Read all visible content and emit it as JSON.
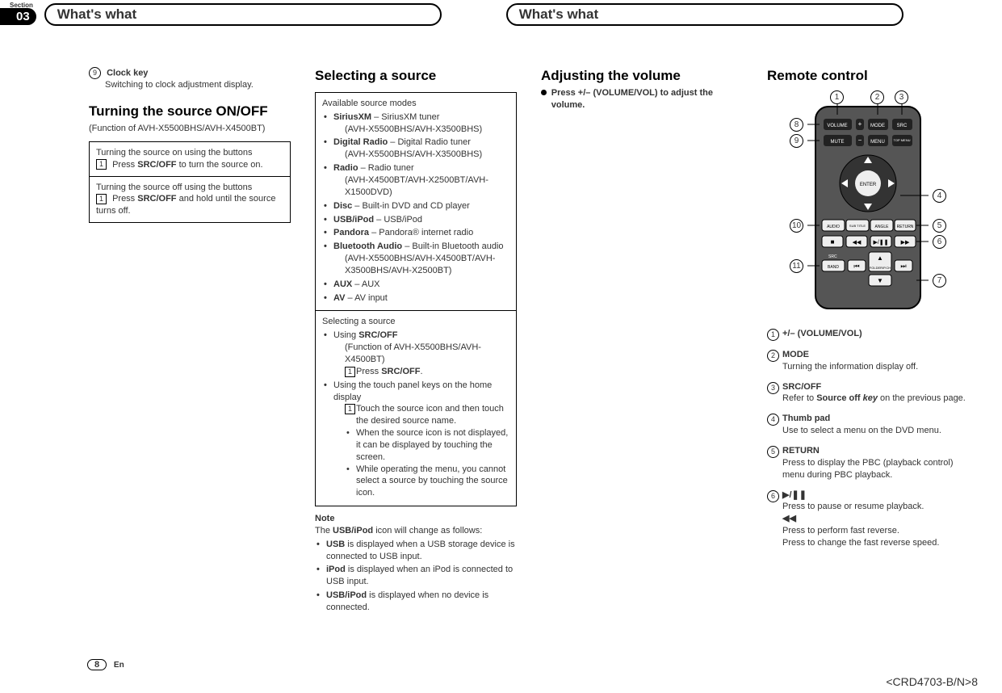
{
  "header": {
    "section_label": "Section",
    "section_num": "03",
    "chapter_left": "What's what",
    "chapter_right": "What's what"
  },
  "col1": {
    "clock_num": "9",
    "clock_title": "Clock key",
    "clock_desc": "Switching to clock adjustment display.",
    "turning_h": "Turning the source ON/OFF",
    "turning_sub": "(Function of AVH-X5500BHS/AVH-X4500BT)",
    "on_head": "Turning the source on using the buttons",
    "on_step_pre": "Press ",
    "on_step_bold": "SRC/OFF",
    "on_step_post": " to turn the source on.",
    "off_head": "Turning the source off using the buttons",
    "off_step_pre": "Press ",
    "off_step_bold": "SRC/OFF",
    "off_step_post": " and hold until the source turns off."
  },
  "col2": {
    "h": "Selecting a source",
    "avail": "Available source modes",
    "s1b": "SiriusXM",
    "s1t": " – SiriusXM tuner",
    "s1s": "(AVH-X5500BHS/AVH-X3500BHS)",
    "s2b": "Digital Radio",
    "s2t": " – Digital Radio tuner",
    "s2s": "(AVH-X5500BHS/AVH-X3500BHS)",
    "s3b": "Radio",
    "s3t": " – Radio tuner",
    "s3s": "(AVH-X4500BT/AVH-X2500BT/AVH-X1500DVD)",
    "s4b": "Disc",
    "s4t": " – Built-in DVD and CD player",
    "s5b": "USB/iPod",
    "s5t": " – USB/iPod",
    "s6b": "Pandora",
    "s6t": " – Pandora® internet radio",
    "s7b": "Bluetooth Audio",
    "s7t": " – Built-in Bluetooth audio",
    "s7s": "(AVH-X5500BHS/AVH-X4500BT/AVH-X3500BHS/AVH-X2500BT)",
    "s8b": "AUX",
    "s8t": " – AUX",
    "s9b": "AV",
    "s9t": " – AV input",
    "sel_head": "Selecting a source",
    "u1_pre": "Using ",
    "u1_bold": "SRC/OFF",
    "u1_sub": "(Function of AVH-X5500BHS/AVH-X4500BT)",
    "u1_step_pre": "Press ",
    "u1_step_bold": "SRC/OFF",
    "u1_step_post": ".",
    "u2": "Using the touch panel keys on the home display",
    "u2_step": "Touch the source icon and then touch the desired source name.",
    "u2_b1": "When the source icon is not displayed, it can be displayed by touching the screen.",
    "u2_b2": "While operating the menu, you cannot select a source by touching the source icon.",
    "note_h": "Note",
    "note_pre": "The ",
    "note_bold": "USB/iPod",
    "note_post": " icon will change as follows:",
    "n1b": "USB",
    "n1t": " is displayed when a USB storage device is connected to USB input.",
    "n2b": "iPod",
    "n2t": " is displayed when an iPod is connected to USB input.",
    "n3b": "USB/iPod",
    "n3t": " is displayed when no device is connected."
  },
  "col3": {
    "h": "Adjusting the volume",
    "line": "Press +/– (VOLUME/VOL) to adjust the volume."
  },
  "col4": {
    "h": "Remote control",
    "btn_volume": "VOLUME",
    "btn_mute": "MUTE",
    "btn_mode": "MODE",
    "btn_src": "SRC",
    "btn_menu": "MENU",
    "btn_top": "TOP MENU",
    "btn_enter": "ENTER",
    "btn_audio": "AUDIO",
    "btn_sub": "SUB TITLE",
    "btn_angle": "ANGLE",
    "btn_return": "RETURN",
    "btn_band": "BAND",
    "btn_folder": "FOLDER/P.CH",
    "r1n": "1",
    "r1t": "+/– (VOLUME/VOL)",
    "r2n": "2",
    "r2t": "MODE",
    "r2d": "Turning the information display off.",
    "r3n": "3",
    "r3t": "SRC/OFF",
    "r3d_pre": "Refer to ",
    "r3d_b": "Source off ",
    "r3d_i": "key",
    "r3d_post": " on the previous page.",
    "r4n": "4",
    "r4t": "Thumb pad",
    "r4d": "Use to select a menu on the DVD menu.",
    "r5n": "5",
    "r5t": "RETURN",
    "r5d": "Press to display the PBC (playback control) menu during PBC playback.",
    "r6n": "6",
    "r6t": "▶/❚❚",
    "r6d": "Press to pause or resume playback.",
    "r6t2": "◀◀",
    "r6d2": "Press to perform fast reverse.",
    "r6d3": "Press to change the fast reverse speed."
  },
  "footer": {
    "page": "8",
    "lang": "En",
    "code": "<CRD4703-B/N>8"
  }
}
